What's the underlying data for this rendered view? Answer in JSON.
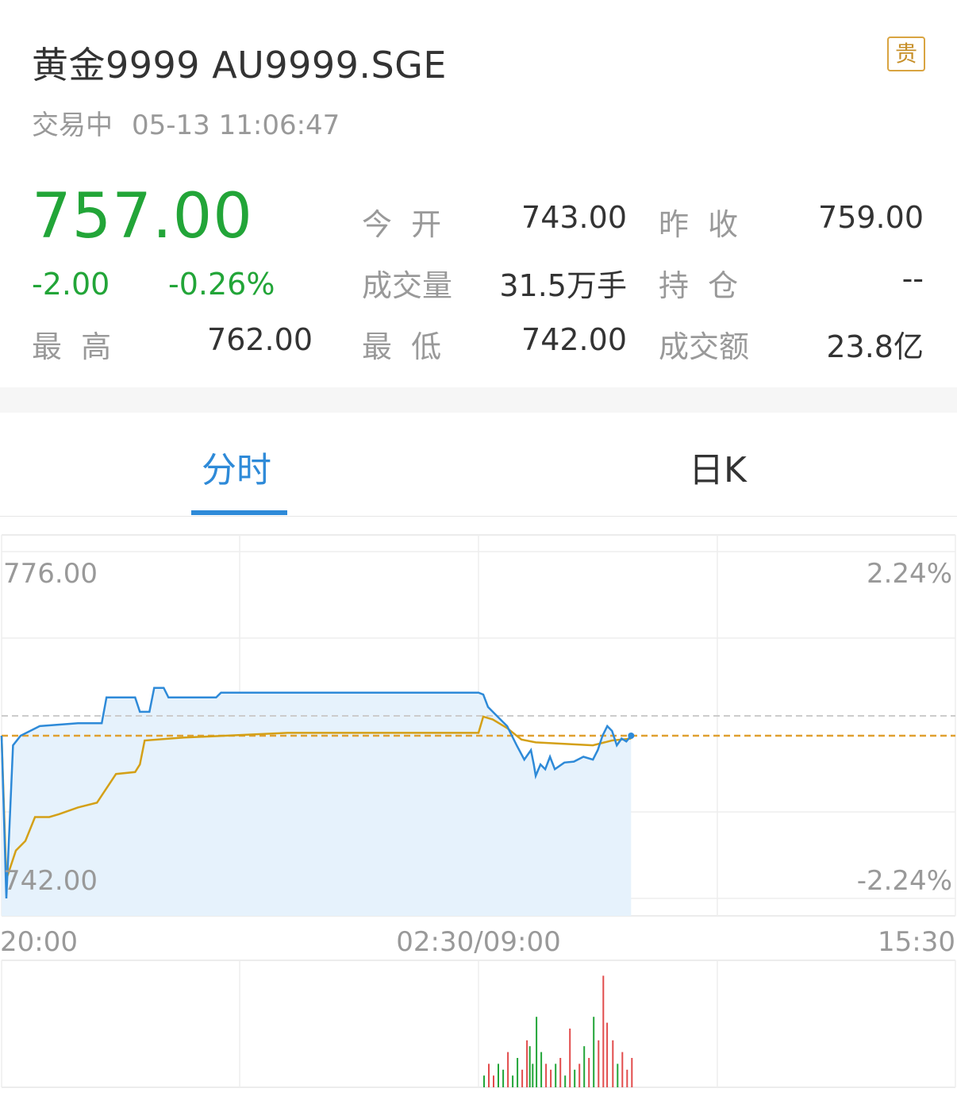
{
  "header": {
    "title": "黄金9999 AU9999.SGE",
    "badge": "贵",
    "status": "交易中",
    "datetime": "05-13 11:06:47"
  },
  "quote": {
    "price": "757.00",
    "change": "-2.00",
    "change_pct": "-0.26%",
    "high_label": "最  高",
    "high": "762.00",
    "open_label": "今  开",
    "open": "743.00",
    "prev_close_label": "昨  收",
    "prev_close": "759.00",
    "volume_label": "成交量",
    "volume": "31.5万手",
    "position_label": "持  仓",
    "position": "--",
    "low_label": "最  低",
    "low": "742.00",
    "turnover_label": "成交额",
    "turnover": "23.8亿"
  },
  "tabs": [
    {
      "label": "分时",
      "active": true
    },
    {
      "label": "日K",
      "active": false
    }
  ],
  "colors": {
    "accent": "#2e8ad8",
    "down": "#22a538",
    "up": "#e24c4c",
    "avg_line": "#d4a017",
    "prev_close_line": "#e0a030"
  },
  "chart_data": {
    "type": "line",
    "y_left_labels": [
      "776.00",
      "742.00"
    ],
    "y_right_labels": [
      "2.24%",
      "-2.24%"
    ],
    "x_labels": [
      "20:00",
      "02:30/09:00",
      "15:30"
    ],
    "ylim": [
      742.0,
      776.0
    ],
    "prev_close": 759.0,
    "series": [
      {
        "points": [
          [
            0,
            759.0
          ],
          [
            0.005,
            742.0
          ],
          [
            0.012,
            758.0
          ],
          [
            0.02,
            759.0
          ],
          [
            0.04,
            760.0
          ],
          [
            0.08,
            760.3
          ],
          [
            0.105,
            760.3
          ],
          [
            0.11,
            763.0
          ],
          [
            0.14,
            763.0
          ],
          [
            0.145,
            761.5
          ],
          [
            0.155,
            761.5
          ],
          [
            0.16,
            764.0
          ],
          [
            0.17,
            764.0
          ],
          [
            0.175,
            763.0
          ],
          [
            0.19,
            763.0
          ],
          [
            0.2,
            763.0
          ],
          [
            0.225,
            763.0
          ],
          [
            0.23,
            763.5
          ],
          [
            0.4,
            763.5
          ],
          [
            0.5,
            763.5
          ],
          [
            0.505,
            763.3
          ],
          [
            0.51,
            762.0
          ],
          [
            0.52,
            761.0
          ],
          [
            0.53,
            760.0
          ],
          [
            0.535,
            759.0
          ],
          [
            0.54,
            758.0
          ],
          [
            0.548,
            756.5
          ],
          [
            0.555,
            757.5
          ],
          [
            0.558,
            756.0
          ],
          [
            0.56,
            754.8
          ],
          [
            0.565,
            756.0
          ],
          [
            0.57,
            755.5
          ],
          [
            0.575,
            756.8
          ],
          [
            0.58,
            755.5
          ],
          [
            0.59,
            756.2
          ],
          [
            0.6,
            756.3
          ],
          [
            0.61,
            756.8
          ],
          [
            0.62,
            756.5
          ],
          [
            0.625,
            757.5
          ],
          [
            0.63,
            759.0
          ],
          [
            0.635,
            760.0
          ],
          [
            0.64,
            759.5
          ],
          [
            0.645,
            758.0
          ],
          [
            0.65,
            758.7
          ],
          [
            0.655,
            758.4
          ],
          [
            0.66,
            759.0
          ]
        ]
      },
      {
        "points": [
          [
            0,
            759.0
          ],
          [
            0.005,
            744.0
          ],
          [
            0.015,
            747.0
          ],
          [
            0.025,
            748.0
          ],
          [
            0.035,
            750.5
          ],
          [
            0.05,
            750.5
          ],
          [
            0.06,
            750.8
          ],
          [
            0.08,
            751.5
          ],
          [
            0.1,
            752.0
          ],
          [
            0.12,
            755.0
          ],
          [
            0.14,
            755.2
          ],
          [
            0.145,
            756.0
          ],
          [
            0.15,
            758.5
          ],
          [
            0.19,
            758.8
          ],
          [
            0.3,
            759.3
          ],
          [
            0.5,
            759.3
          ],
          [
            0.505,
            761.0
          ],
          [
            0.515,
            760.7
          ],
          [
            0.53,
            759.8
          ],
          [
            0.545,
            758.6
          ],
          [
            0.56,
            758.3
          ],
          [
            0.58,
            758.2
          ],
          [
            0.6,
            758.1
          ],
          [
            0.62,
            758.0
          ],
          [
            0.64,
            758.5
          ],
          [
            0.66,
            758.7
          ]
        ]
      }
    ],
    "volume_bars": [
      [
        0.505,
        1,
        "down"
      ],
      [
        0.51,
        2,
        "up"
      ],
      [
        0.515,
        1,
        "up"
      ],
      [
        0.52,
        2,
        "down"
      ],
      [
        0.525,
        1.5,
        "down"
      ],
      [
        0.53,
        3,
        "up"
      ],
      [
        0.535,
        1,
        "down"
      ],
      [
        0.54,
        2.5,
        "down"
      ],
      [
        0.545,
        1.5,
        "up"
      ],
      [
        0.55,
        4,
        "up"
      ],
      [
        0.553,
        3.5,
        "down"
      ],
      [
        0.556,
        2,
        "down"
      ],
      [
        0.56,
        6,
        "down"
      ],
      [
        0.565,
        3,
        "down"
      ],
      [
        0.57,
        2,
        "up"
      ],
      [
        0.575,
        1.5,
        "up"
      ],
      [
        0.58,
        2,
        "down"
      ],
      [
        0.585,
        2.5,
        "up"
      ],
      [
        0.59,
        1,
        "down"
      ],
      [
        0.595,
        5,
        "up"
      ],
      [
        0.6,
        1.5,
        "down"
      ],
      [
        0.605,
        2,
        "up"
      ],
      [
        0.61,
        3.5,
        "down"
      ],
      [
        0.615,
        2.5,
        "up"
      ],
      [
        0.62,
        6,
        "down"
      ],
      [
        0.625,
        4,
        "up"
      ],
      [
        0.63,
        9.5,
        "up"
      ],
      [
        0.634,
        5.5,
        "up"
      ],
      [
        0.64,
        4,
        "up"
      ],
      [
        0.645,
        2,
        "down"
      ],
      [
        0.65,
        3,
        "up"
      ],
      [
        0.655,
        1.5,
        "up"
      ],
      [
        0.66,
        2.5,
        "up"
      ]
    ]
  }
}
